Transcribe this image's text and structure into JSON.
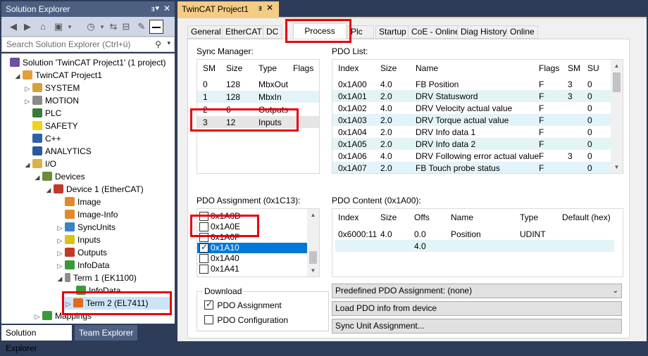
{
  "solution_explorer": {
    "title": "Solution Explorer",
    "pin_icon": "pin-icon",
    "search_placeholder": "Search Solution Explorer (Ctrl+ü)",
    "tree": [
      {
        "label": "Solution 'TwinCAT Project1' (1 project)",
        "icon": "solution-icon"
      },
      {
        "label": "TwinCAT Project1",
        "icon": "project-icon"
      },
      {
        "label": "SYSTEM",
        "icon": "system-icon"
      },
      {
        "label": "MOTION",
        "icon": "motion-icon"
      },
      {
        "label": "PLC",
        "icon": "plc-icon"
      },
      {
        "label": "SAFETY",
        "icon": "safety-icon"
      },
      {
        "label": "C++",
        "icon": "cpp-icon"
      },
      {
        "label": "ANALYTICS",
        "icon": "analytics-icon"
      },
      {
        "label": "I/O",
        "icon": "io-icon"
      },
      {
        "label": "Devices",
        "icon": "devices-icon"
      },
      {
        "label": "Device 1 (EtherCAT)",
        "icon": "ethercat-device-icon"
      },
      {
        "label": "Image",
        "icon": "image-icon"
      },
      {
        "label": "Image-Info",
        "icon": "image-info-icon"
      },
      {
        "label": "SyncUnits",
        "icon": "syncunits-icon"
      },
      {
        "label": "Inputs",
        "icon": "inputs-icon"
      },
      {
        "label": "Outputs",
        "icon": "outputs-icon"
      },
      {
        "label": "InfoData",
        "icon": "infodata-icon"
      },
      {
        "label": "Term 1 (EK1100)",
        "icon": "terminal-icon"
      },
      {
        "label": "InfoData",
        "icon": "infodata-icon"
      },
      {
        "label": "Term 2 (EL7411)",
        "icon": "terminal-icon"
      },
      {
        "label": "Mappings",
        "icon": "mappings-icon"
      }
    ],
    "bottom_tabs": [
      "Solution Explorer",
      "Team Explorer"
    ]
  },
  "document": {
    "tab_title": "TwinCAT Project1",
    "tabs": [
      "General",
      "EtherCAT",
      "DC",
      "Process Data",
      "Plc",
      "Startup",
      "CoE - Online",
      "Diag History",
      "Online"
    ],
    "active_tab": "Process Data",
    "sync_manager": {
      "label": "Sync Manager:",
      "columns": [
        "SM",
        "Size",
        "Type",
        "Flags"
      ],
      "rows": [
        [
          "0",
          "128",
          "MbxOut",
          ""
        ],
        [
          "1",
          "128",
          "MbxIn",
          ""
        ],
        [
          "2",
          "6",
          "Outputs",
          ""
        ],
        [
          "3",
          "12",
          "Inputs",
          ""
        ]
      ]
    },
    "pdo_list": {
      "label": "PDO List:",
      "columns": [
        "Index",
        "Size",
        "Name",
        "Flags",
        "SM",
        "SU"
      ],
      "rows": [
        [
          "0x1A00",
          "4.0",
          "FB Position",
          "F",
          "3",
          "0"
        ],
        [
          "0x1A01",
          "2.0",
          "DRV Statusword",
          "F",
          "3",
          "0"
        ],
        [
          "0x1A02",
          "4.0",
          "DRV Velocity actual value",
          "F",
          "",
          "0"
        ],
        [
          "0x1A03",
          "2.0",
          "DRV Torque actual value",
          "F",
          "",
          "0"
        ],
        [
          "0x1A04",
          "2.0",
          "DRV Info data 1",
          "F",
          "",
          "0"
        ],
        [
          "0x1A05",
          "2.0",
          "DRV Info data 2",
          "F",
          "",
          "0"
        ],
        [
          "0x1A06",
          "4.0",
          "DRV Following error actual value",
          "F",
          "3",
          "0"
        ],
        [
          "0x1A07",
          "2.0",
          "FB Touch probe status",
          "F",
          "",
          "0"
        ]
      ]
    },
    "pdo_assignment": {
      "label": "PDO Assignment (0x1C13):",
      "items": [
        {
          "label": "0x1A0D",
          "checked": false
        },
        {
          "label": "0x1A0E",
          "checked": false
        },
        {
          "label": "0x1A0F",
          "checked": false
        },
        {
          "label": "0x1A10",
          "checked": true
        },
        {
          "label": "0x1A40",
          "checked": false
        },
        {
          "label": "0x1A41",
          "checked": false
        }
      ]
    },
    "pdo_content": {
      "label": "PDO Content (0x1A00):",
      "columns": [
        "Index",
        "Size",
        "Offs",
        "Name",
        "Type",
        "Default (hex)"
      ],
      "rows": [
        [
          "0x6000:11",
          "4.0",
          "0.0",
          "Position",
          "UDINT",
          ""
        ],
        [
          "",
          "",
          "4.0",
          "",
          "",
          ""
        ]
      ]
    },
    "download": {
      "label": "Download",
      "pdo_assignment": {
        "label": "PDO Assignment",
        "checked": true
      },
      "pdo_configuration": {
        "label": "PDO Configuration",
        "checked": false
      }
    },
    "predefined_dropdown": "Predefined PDO Assignment: (none)",
    "load_button": "Load PDO info from device",
    "sync_unit_button": "Sync Unit Assignment...",
    "highlight_color": "#e8000b",
    "accent_color": "#f5cc84"
  }
}
